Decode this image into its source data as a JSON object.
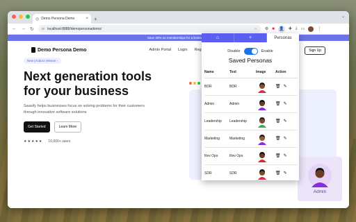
{
  "browser": {
    "tab_title": "Demo Persona Demo",
    "url": "localhost:8888/demopersonademo/",
    "new_tab_symbol": "+",
    "promo_text": "Save 30% on memberships for a limited time"
  },
  "site": {
    "brand": "Demo Persona Demo",
    "nav": [
      "Admin Portal",
      "Login",
      "Register"
    ],
    "signup_label": "Sign Up",
    "badge": "New product release",
    "headline_1": "Next generation tools",
    "headline_2": "for your business",
    "description": "Saasify helps businesses focus on solving problems for their customers through innovative software solutions",
    "cta_primary": "Get Started",
    "cta_secondary": "Learn More",
    "stars": "★★★★★",
    "users": "10,000+ users",
    "card_label": "Admin"
  },
  "extension": {
    "tabs": [
      {
        "icon": "home-icon",
        "label": "⌂"
      },
      {
        "icon": "plus-icon",
        "label": "+"
      },
      {
        "icon": "",
        "label": "Personas"
      }
    ],
    "toggle": {
      "off_label": "Disable",
      "on_label": "Enable",
      "state": "enabled"
    },
    "title": "Saved Personas",
    "columns": [
      "Name",
      "Text",
      "Image",
      "Action"
    ],
    "personas": [
      {
        "name": "BDR",
        "text": "BDR",
        "skin": "#8a4f33",
        "hair": "#1a1a1a",
        "shirt": "#d92b4d"
      },
      {
        "name": "Admin",
        "text": "Admin",
        "skin": "#6b3b23",
        "hair": "#111",
        "shirt": "#8a2be2"
      },
      {
        "name": "Leadership",
        "text": "Leadership",
        "skin": "#7a4a2e",
        "hair": "#222",
        "shirt": "#2bb04a"
      },
      {
        "name": "Marketing",
        "text": "Marketing",
        "skin": "#9a5a3a",
        "hair": "#1a1a1a",
        "shirt": "#8a2be2"
      },
      {
        "name": "Rev Ops",
        "text": "Rev Ops",
        "skin": "#6b3b23",
        "hair": "#111",
        "shirt": "#d92b2b"
      },
      {
        "name": "SDR",
        "text": "SDR",
        "skin": "#7a4a2e",
        "hair": "#111",
        "shirt": "#d92b4d"
      }
    ]
  },
  "colors": {
    "accent": "#5b5ef0",
    "toggle": "#1a73e8"
  }
}
